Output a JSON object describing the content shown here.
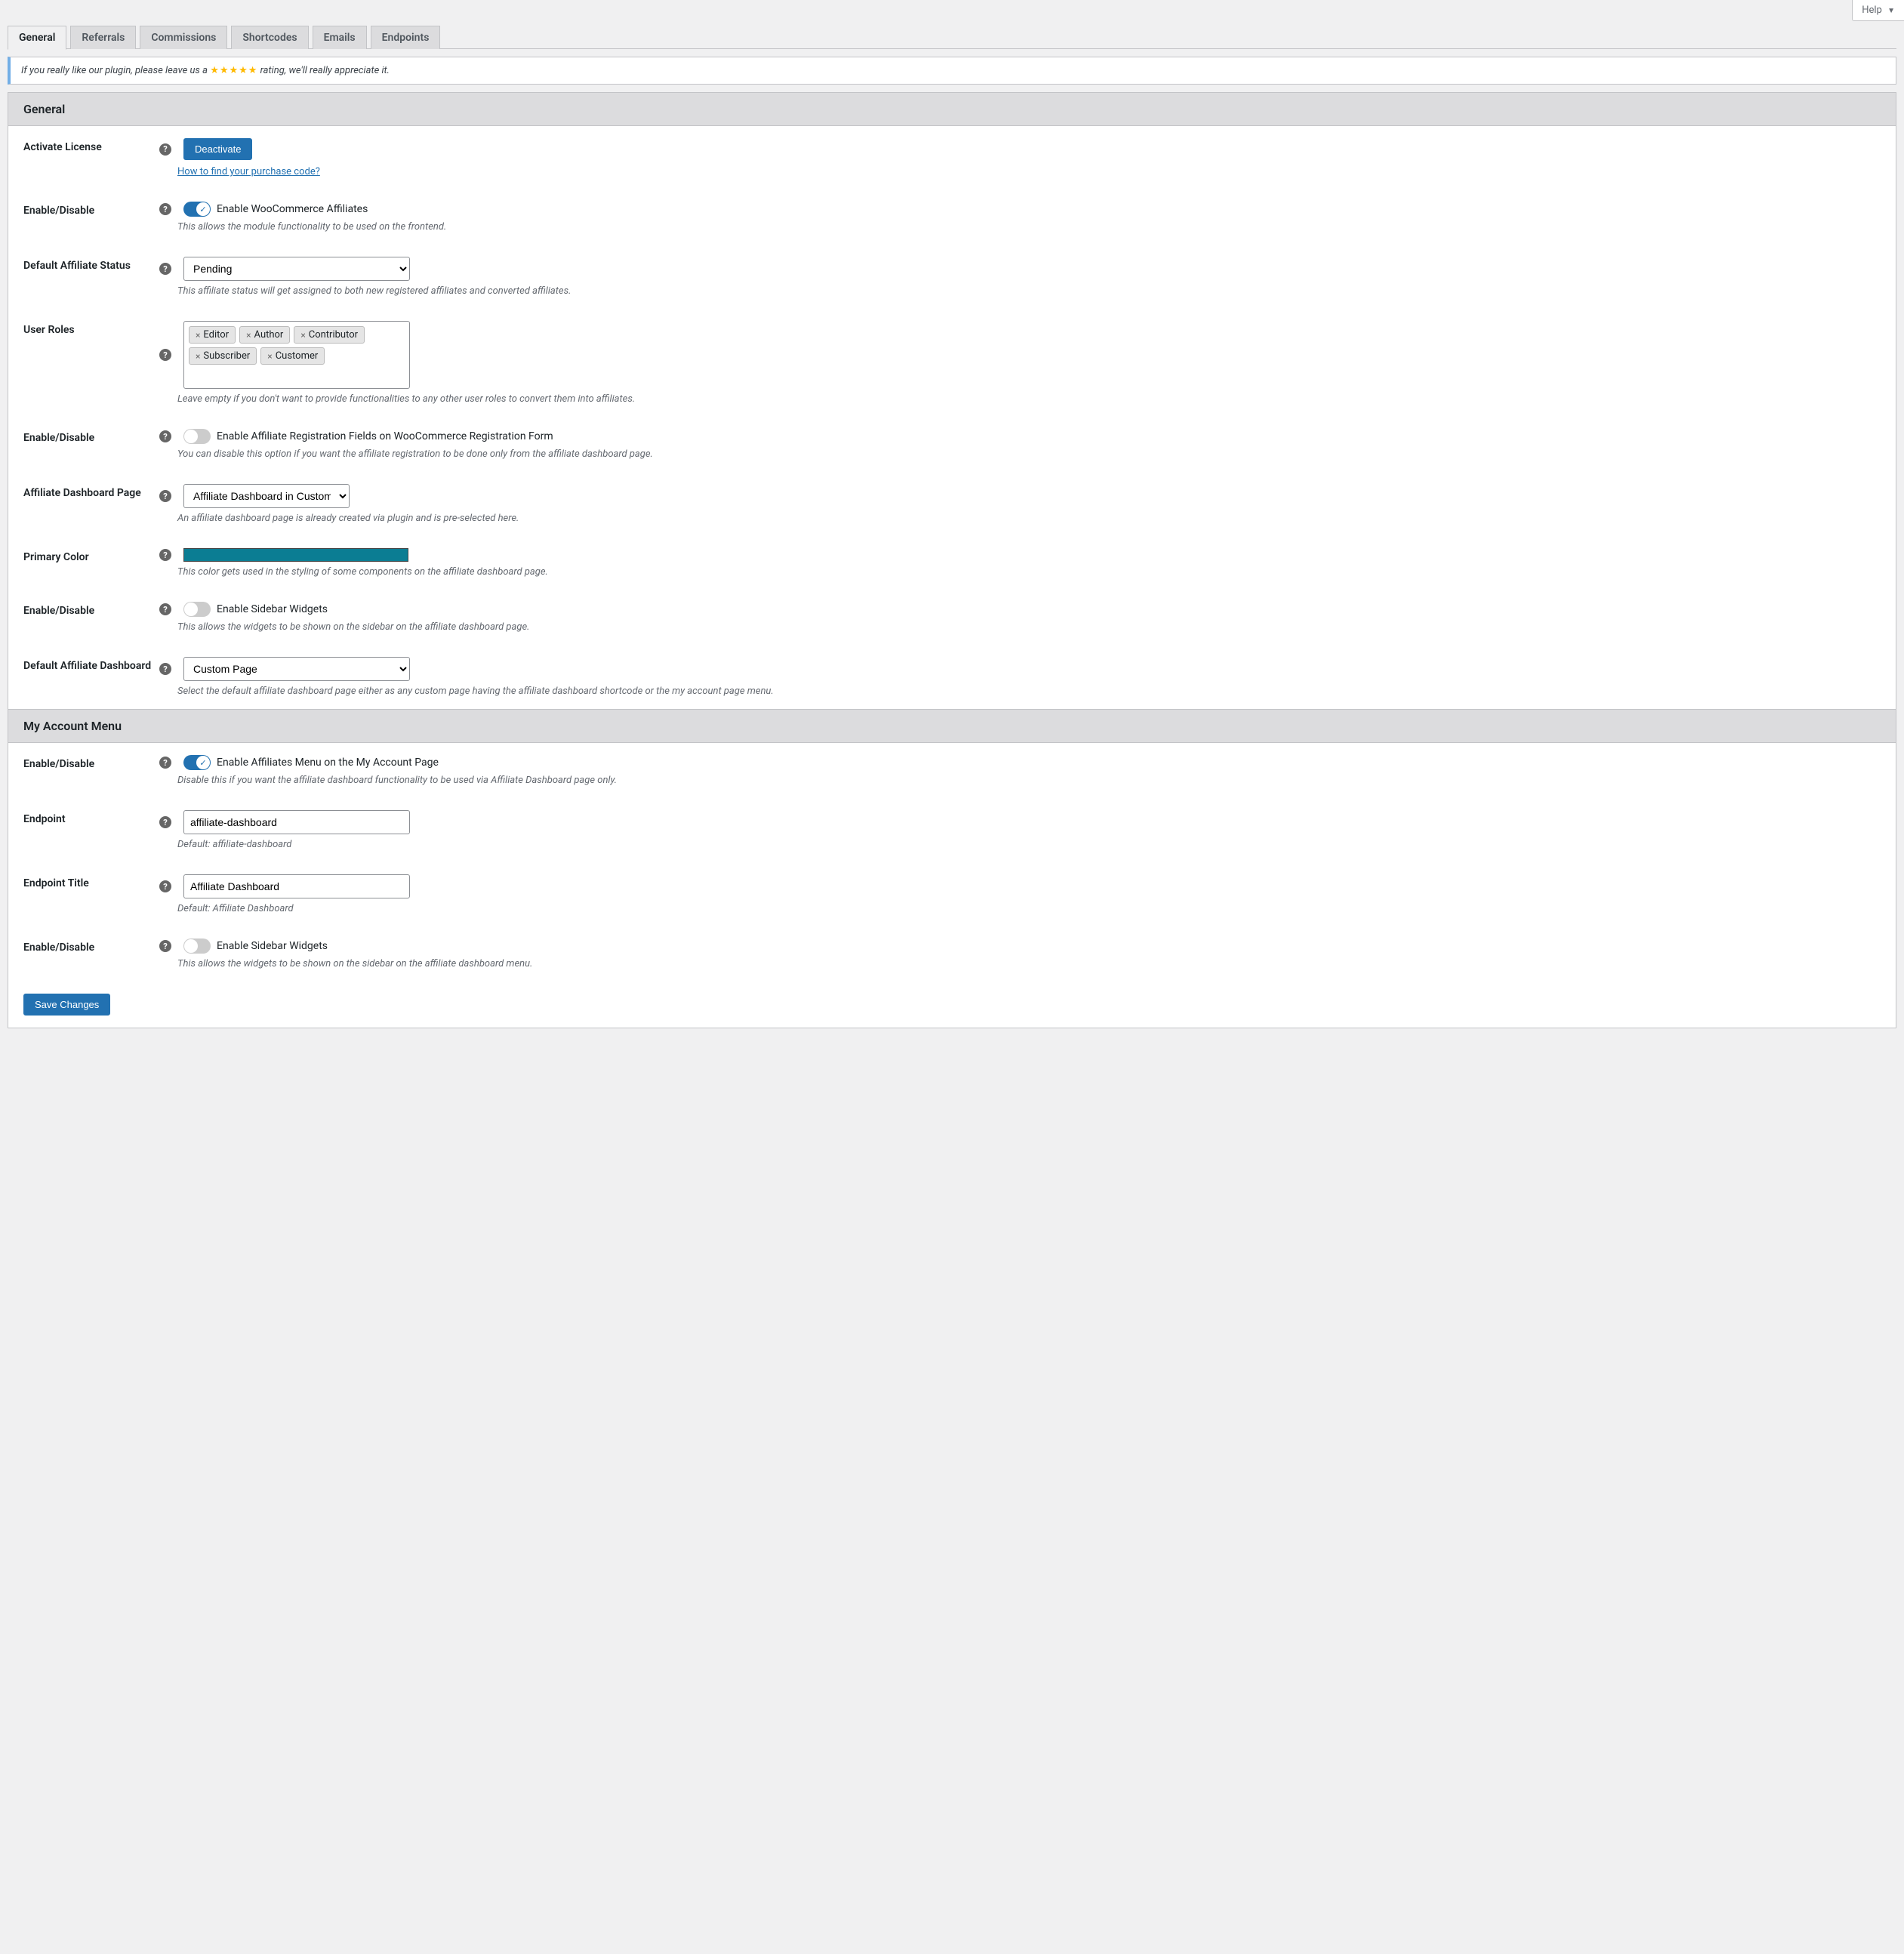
{
  "help_label": "Help",
  "tabs": {
    "general": "General",
    "referrals": "Referrals",
    "commissions": "Commissions",
    "shortcodes": "Shortcodes",
    "emails": "Emails",
    "endpoints": "Endpoints"
  },
  "notice": {
    "before": "If you really like our plugin, please leave us a ",
    "after": " rating, we'll really appreciate it."
  },
  "sections": {
    "general_title": "General",
    "my_account_title": "My Account Menu"
  },
  "fields": {
    "activate_license": {
      "label": "Activate License",
      "button": "Deactivate",
      "link": "How to find your purchase code?"
    },
    "enable_module": {
      "label": "Enable/Disable",
      "toggle_label": "Enable WooCommerce Affiliates",
      "desc": "This allows the module functionality to be used on the frontend."
    },
    "default_status": {
      "label": "Default Affiliate Status",
      "value": "Pending",
      "desc": "This affiliate status will get assigned to both new registered affiliates and converted affiliates."
    },
    "user_roles": {
      "label": "User Roles",
      "tags": [
        "Editor",
        "Author",
        "Contributor",
        "Subscriber",
        "Customer"
      ],
      "desc": "Leave empty if you don't want to provide functionalities to any other user roles to convert them into affiliates."
    },
    "enable_reg_fields": {
      "label": "Enable/Disable",
      "toggle_label": "Enable Affiliate Registration Fields on WooCommerce Registration Form",
      "desc": "You can disable this option if you want the affiliate registration to be done only from the affiliate dashboard page."
    },
    "dashboard_page": {
      "label": "Affiliate Dashboard Page",
      "value": "Affiliate Dashboard in Custom Page",
      "desc": "An affiliate dashboard page is already created via plugin and is pre-selected here."
    },
    "primary_color": {
      "label": "Primary Color",
      "value": "#0b7d93",
      "desc": "This color gets used in the styling of some components on the affiliate dashboard page."
    },
    "enable_sidebar": {
      "label": "Enable/Disable",
      "toggle_label": "Enable Sidebar Widgets",
      "desc": "This allows the widgets to be shown on the sidebar on the affiliate dashboard page."
    },
    "default_dashboard": {
      "label": "Default Affiliate Dashboard",
      "value": "Custom Page",
      "desc": "Select the default affiliate dashboard page either as any custom page having the affiliate dashboard shortcode or the my account page menu."
    },
    "enable_myaccount": {
      "label": "Enable/Disable",
      "toggle_label": "Enable Affiliates Menu on the My Account Page",
      "desc": "Disable this if you want the affiliate dashboard functionality to be used via Affiliate Dashboard page only."
    },
    "endpoint": {
      "label": "Endpoint",
      "value": "affiliate-dashboard",
      "desc": "Default: affiliate-dashboard"
    },
    "endpoint_title": {
      "label": "Endpoint Title",
      "value": "Affiliate Dashboard",
      "desc": "Default: Affiliate Dashboard"
    },
    "enable_sidebar_menu": {
      "label": "Enable/Disable",
      "toggle_label": "Enable Sidebar Widgets",
      "desc": "This allows the widgets to be shown on the sidebar on the affiliate dashboard menu."
    }
  },
  "save_button": "Save Changes"
}
